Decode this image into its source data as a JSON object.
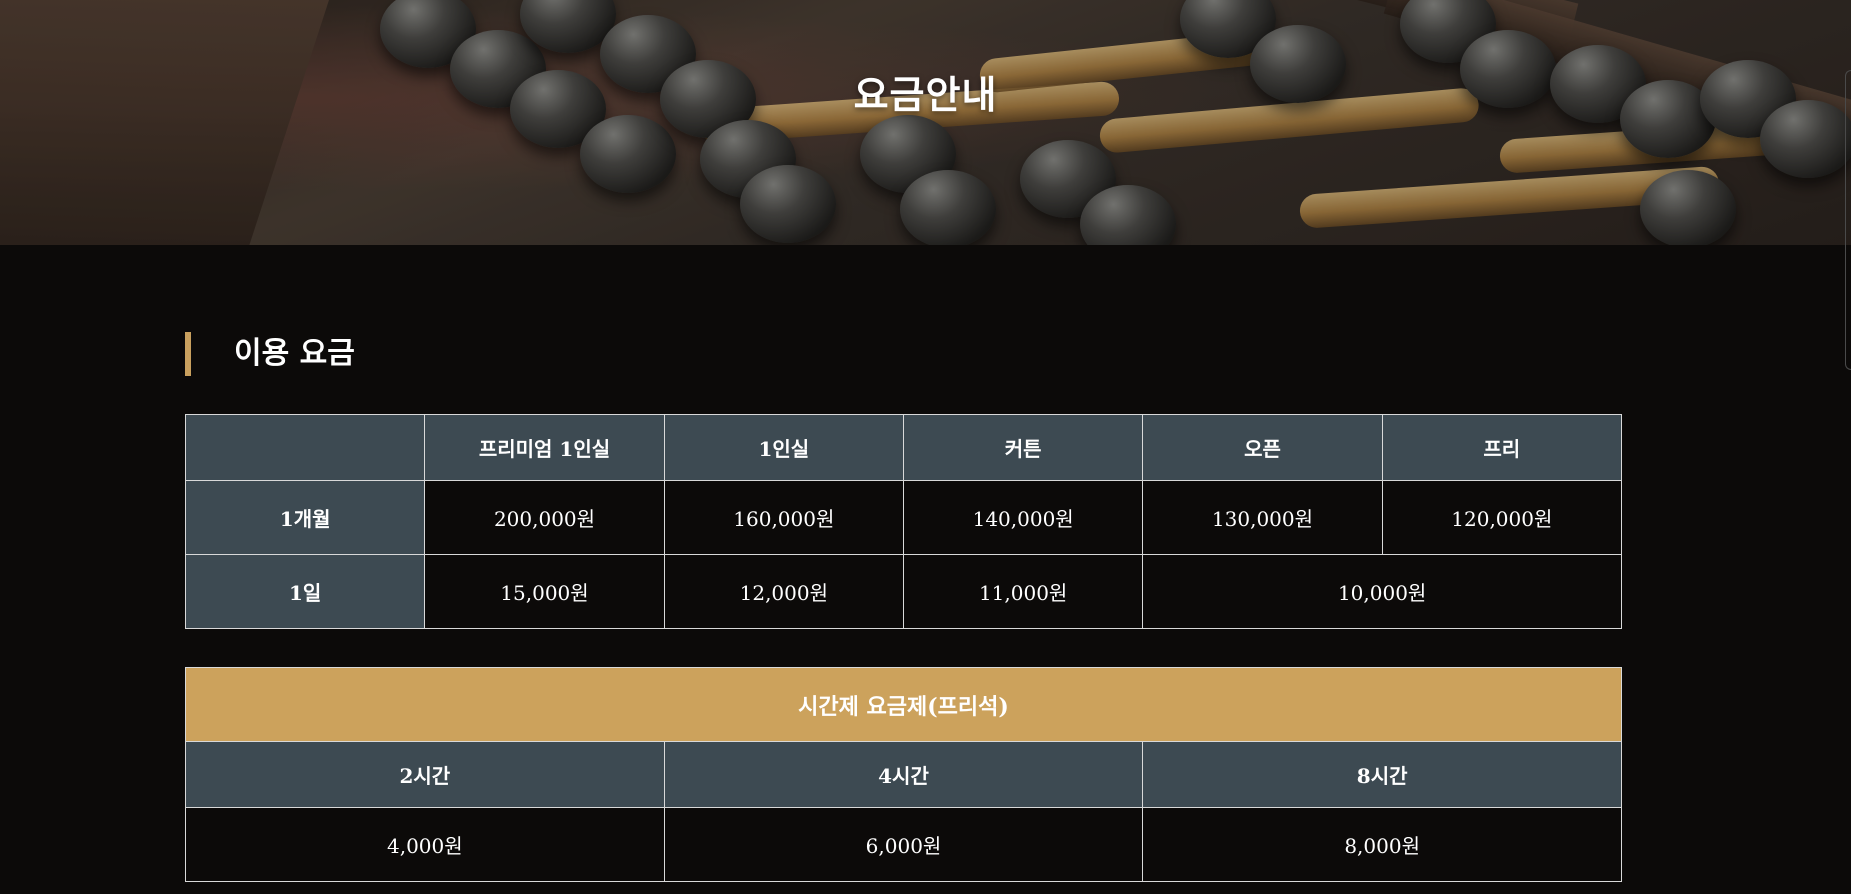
{
  "hero": {
    "title": "요금안내"
  },
  "section": {
    "heading": "이용 요금",
    "accent_color": "#c9a05e"
  },
  "price_table": {
    "corner": "",
    "columns": [
      "프리미엄 1인실",
      "1인실",
      "커튼",
      "오픈",
      "프리"
    ],
    "rows": [
      {
        "label": "1개월",
        "cells": [
          "200,000원",
          "160,000원",
          "140,000원",
          "130,000원",
          "120,000원"
        ]
      },
      {
        "label": "1일",
        "cells": [
          "15,000원",
          "12,000원",
          "11,000원",
          "10,000원"
        ]
      }
    ],
    "header_color": "#3d4a52"
  },
  "time_table": {
    "caption": "시간제 요금제(프리석)",
    "caption_color": "#cca25c",
    "columns": [
      "2시간",
      "4시간",
      "8시간"
    ],
    "values": [
      "4,000원",
      "6,000원",
      "8,000원"
    ]
  }
}
